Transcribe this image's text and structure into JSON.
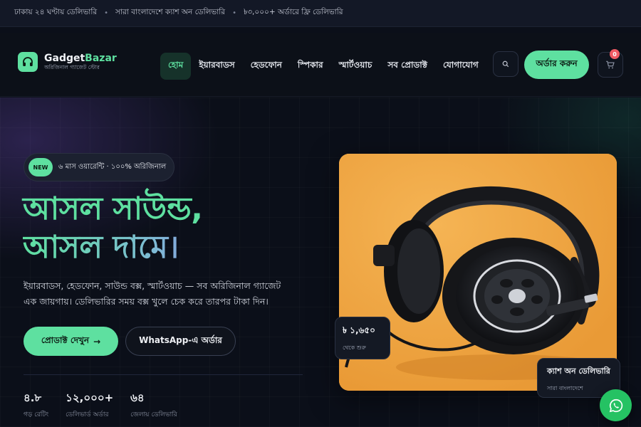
{
  "topbar": {
    "items": [
      "ঢাকায় ২৪ ঘণ্টায় ডেলিভারি",
      "সারা বাংলাদেশে ক্যাশ অন ডেলিভারি",
      "৳৩,০০০+ অর্ডারে ফ্রি ডেলিভারি"
    ],
    "separator": "•"
  },
  "header": {
    "logo_name_a": "Gadget",
    "logo_name_b": "Bazar",
    "logo_sub": "অরিজিনাল গ্যাজেট স্টোর",
    "nav": [
      "হোম",
      "ইয়ারবাডস",
      "হেডফোন",
      "স্পিকার",
      "স্মার্টওয়াচ",
      "সব প্রোডাক্ট",
      "যোগাযোগ"
    ],
    "active_index": 0,
    "order_label": "অর্ডার করুন",
    "cart_count": "0"
  },
  "hero": {
    "pill_badge": "NEW",
    "pill_text": "৬ মাস ওয়ারেন্টি · ১০০% অরিজিনাল",
    "headline_line1": "আসল সাউন্ড,",
    "headline_line2": "আসল দামে।",
    "description": "ইয়ারবাডস, হেডফোন, সাউন্ড বক্স, স্মার্টওয়াচ — সব অরিজিনাল গ্যাজেট এক জায়গায়। ডেলিভারির সময় বক্স খুলে চেক করে তারপর টাকা দিন।",
    "cta_primary": "প্রোডাক্ট দেখুন",
    "cta_primary_arrow": "→",
    "cta_secondary": "WhatsApp-এ অর্ডার",
    "stats": [
      {
        "num": "৪.৮",
        "label": "গড় রেটিং"
      },
      {
        "num": "১২,০০০+",
        "label": "ডেলিভার্ড অর্ডার"
      },
      {
        "num": "৬৪",
        "label": "জেলায় ডেলিভারি"
      }
    ]
  },
  "product": {
    "price": "৳ ১,৬৫০",
    "price_sub": "থেকে শুরু",
    "cod_title": "ক্যাশ অন ডেলিভারি",
    "cod_sub": "সারা বাংলাদেশে"
  },
  "colors": {
    "accent": "#5ee0a0",
    "background": "#0b0f19",
    "product_bg": "#f0a642",
    "whatsapp": "#25c263"
  },
  "icons": {
    "logo": "headphones-icon",
    "search": "search-icon",
    "cart": "cart-icon",
    "whatsapp": "whatsapp-icon"
  }
}
